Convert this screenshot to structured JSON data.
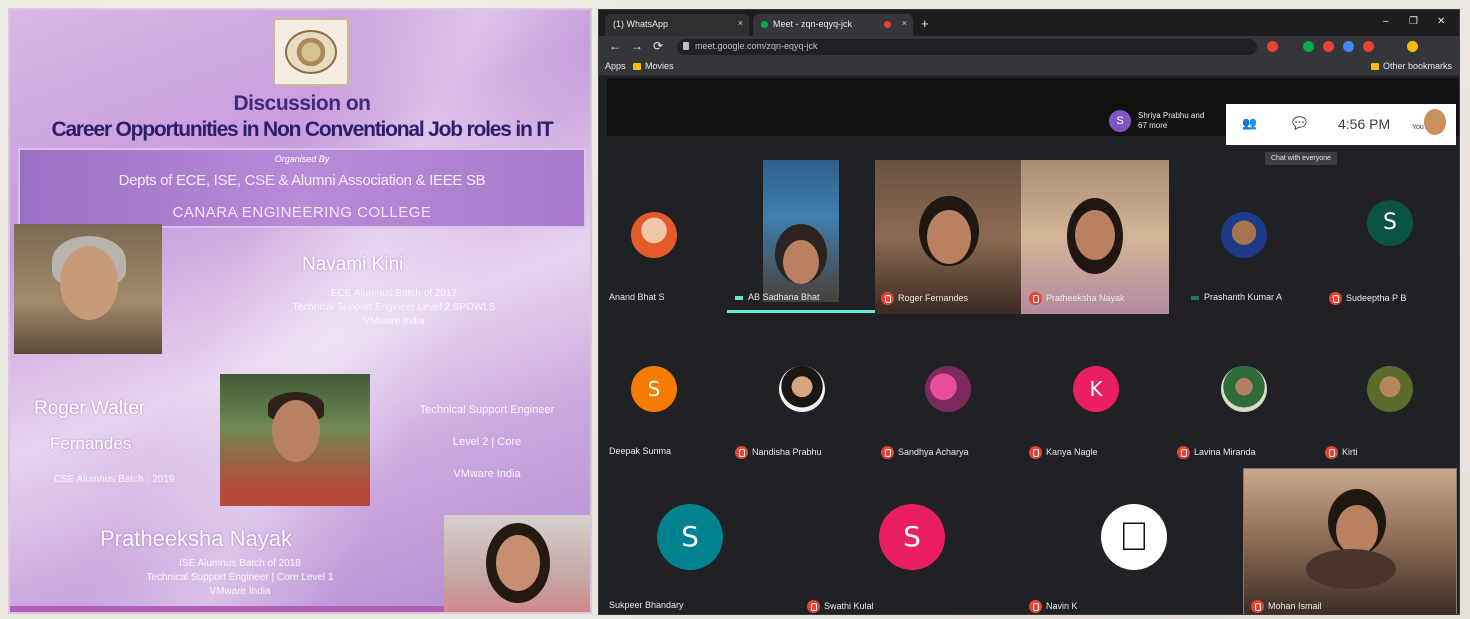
{
  "poster": {
    "heading": "Discussion on",
    "title": "Career Opportunities in Non Conventional Job roles in IT",
    "organised_by": "Organised By",
    "departments": "Depts of ECE, ISE, CSE & Alumni Association & IEEE SB",
    "college": "CANARA ENGINEERING COLLEGE",
    "speakers": [
      {
        "name": "Navami Kini",
        "line1": "ECE Alumnus Batch of 2017",
        "line2": "Technical Support Engineer Level 2 SPOWLS",
        "line3": "VMware India"
      },
      {
        "name_line1": "Roger Walter",
        "name_line2": "Fernandes",
        "batch": "CSE Alumnus Batch : 2019",
        "role1": "Technical Support Engineer",
        "role2": "Level 2 | Core",
        "role3": "VMware India"
      },
      {
        "name": "Pratheeksha Nayak",
        "line1": "ISE Alumnus Batch of 2018",
        "line2": "Technical Support Engineer | Core Level 1",
        "line3": "VMware India"
      }
    ]
  },
  "browser": {
    "tabs": [
      {
        "label": "(1) WhatsApp",
        "close": "×"
      },
      {
        "label": "Meet - zqn-eqyq-jck",
        "close": "×"
      }
    ],
    "new_tab": "+",
    "window_controls": [
      "–",
      "❐",
      "✕"
    ],
    "nav": [
      "←",
      "→",
      "⟳"
    ],
    "url": "meet.google.com/zqn-eqyq-jck",
    "bookmarks": {
      "apps": "Apps",
      "folder": "Movies",
      "other": "Other bookmarks"
    },
    "extension_colors": [
      "#ea4335",
      "#00ac47",
      "#ea4335",
      "#4285f4",
      "#ea4335",
      "#fbbc04"
    ]
  },
  "meet": {
    "presenting": {
      "avatar_letter": "S",
      "text": "Shriya Prabhu and 67 more"
    },
    "time": "4:56 PM",
    "you_label": "You",
    "tooltip": "Chat with everyone",
    "participants_row1": [
      {
        "name": "Anand Bhat S"
      },
      {
        "name": "AB Sadhana Bhat"
      },
      {
        "name": "Roger Fernandes"
      },
      {
        "name": "Pratheeksha Nayak"
      },
      {
        "name": "Prashanth Kumar A"
      },
      {
        "name": "Sudeeptha P B",
        "letter": "S",
        "color": "#0b5345"
      }
    ],
    "participants_row2": [
      {
        "name": "Deepak Sunma",
        "letter": "S",
        "color": "#f57c00"
      },
      {
        "name": "Nandisha Prabhu"
      },
      {
        "name": "Sandhya Acharya"
      },
      {
        "name": "Kanya Nagle",
        "letter": "K",
        "color": "#e91e63"
      },
      {
        "name": "Lavina Miranda"
      },
      {
        "name": "Kirti"
      }
    ],
    "participants_row3": [
      {
        "name": "Sukpeer Bhandary",
        "letter": "S",
        "color": "#00838f"
      },
      {
        "name": "Swathi Kulal",
        "letter": "S",
        "color": "#e91e63"
      },
      {
        "name": "Navin K"
      },
      {
        "name": "Mohan Ismail"
      }
    ]
  }
}
